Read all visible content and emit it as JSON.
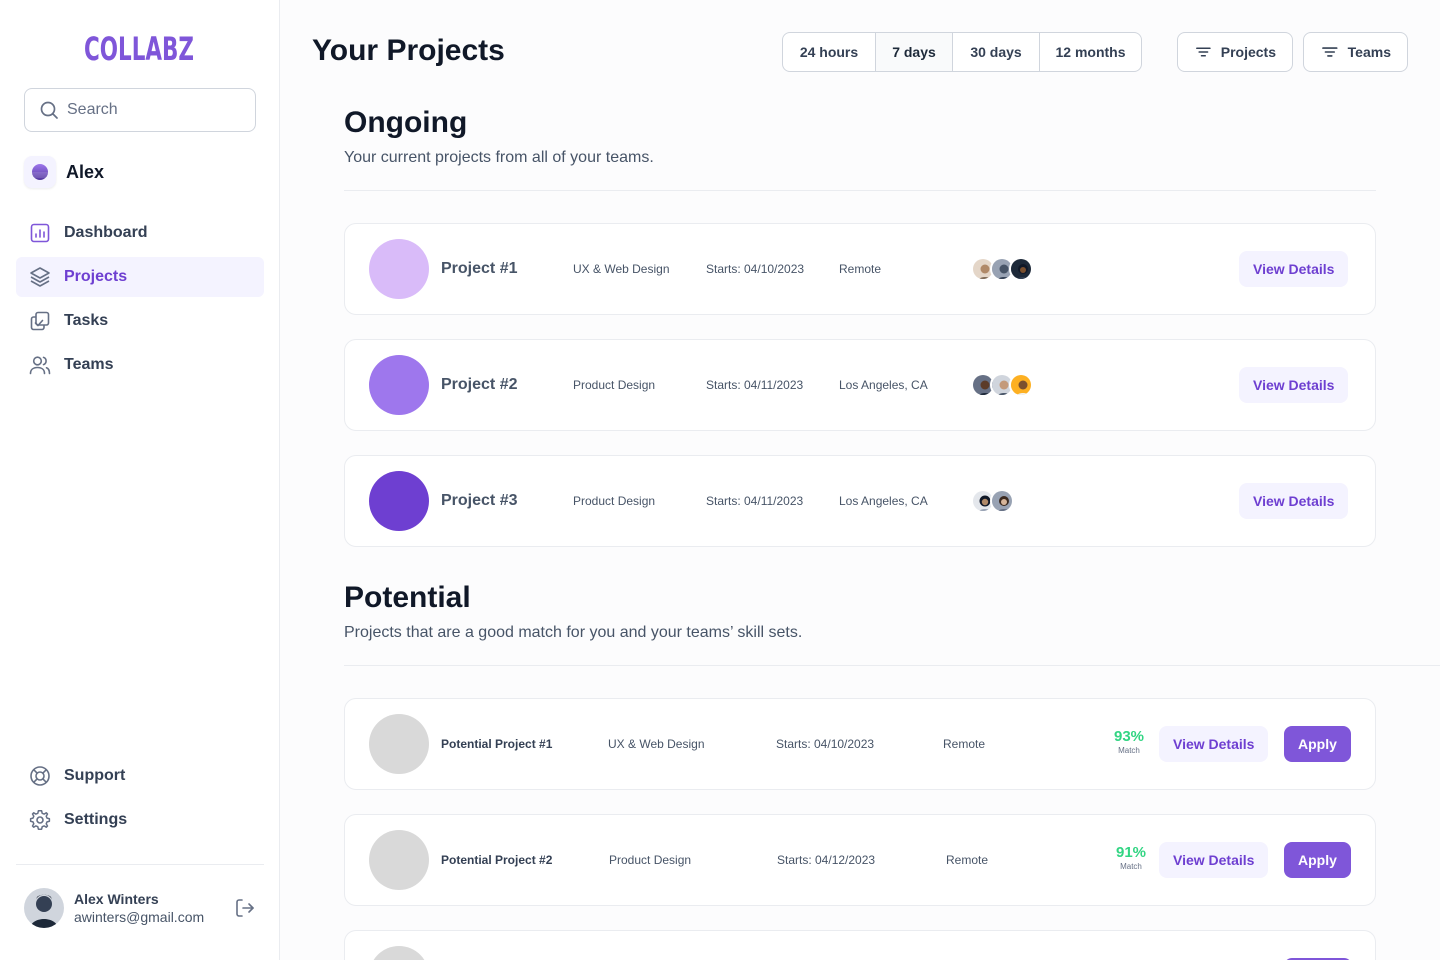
{
  "brand": {
    "logo_text": "COLLABZ",
    "accent": "#7f56d9"
  },
  "search": {
    "placeholder": "Search"
  },
  "workspace_user": {
    "name": "Alex"
  },
  "nav": {
    "main": [
      {
        "label": "Dashboard",
        "icon": "bar-chart-icon",
        "active": false
      },
      {
        "label": "Projects",
        "icon": "layers-icon",
        "active": true
      },
      {
        "label": "Tasks",
        "icon": "check-copy-icon",
        "active": false
      },
      {
        "label": "Teams",
        "icon": "users-icon",
        "active": false
      }
    ],
    "bottom": [
      {
        "label": "Support",
        "icon": "life-buoy-icon"
      },
      {
        "label": "Settings",
        "icon": "gear-icon"
      }
    ]
  },
  "account": {
    "name": "Alex Winters",
    "email": "awinters@gmail.com"
  },
  "header": {
    "title": "Your Projects",
    "ranges": [
      {
        "label": "24 hours",
        "active": false
      },
      {
        "label": "7 days",
        "active": true
      },
      {
        "label": "30 days",
        "active": false
      },
      {
        "label": "12 months",
        "active": false
      }
    ],
    "filters": {
      "projects": "Projects",
      "teams": "Teams"
    }
  },
  "ongoing": {
    "title": "Ongoing",
    "subtitle": "Your current projects from all of your teams.",
    "projects": [
      {
        "name": "Project #1",
        "category": "UX & Web Design",
        "start": "Starts: 04/10/2023",
        "location": "Remote",
        "color": "#d9bbf9",
        "action": "View Details"
      },
      {
        "name": "Project #2",
        "category": "Product Design",
        "start": "Starts: 04/11/2023",
        "location": "Los Angeles, CA",
        "color": "#9e77ed",
        "action": "View Details"
      },
      {
        "name": "Project #3",
        "category": "Product Design",
        "start": "Starts: 04/11/2023",
        "location": "Los Angeles, CA",
        "color": "#6e3fd1",
        "action": "View Details"
      }
    ]
  },
  "potential": {
    "title": "Potential",
    "subtitle": "Projects that are a good match for you and your teams’ skill sets.",
    "projects": [
      {
        "name": "Potential Project #1",
        "category": "UX & Web Design",
        "start": "Starts: 04/10/2023",
        "location": "Remote",
        "match": "93%",
        "match_label": "Match",
        "details": "View Details",
        "apply": "Apply"
      },
      {
        "name": "Potential Project #2",
        "category": "Product Design",
        "start": "Starts: 04/12/2023",
        "location": "Remote",
        "match": "91%",
        "match_label": "Match",
        "details": "View Details",
        "apply": "Apply"
      }
    ]
  }
}
